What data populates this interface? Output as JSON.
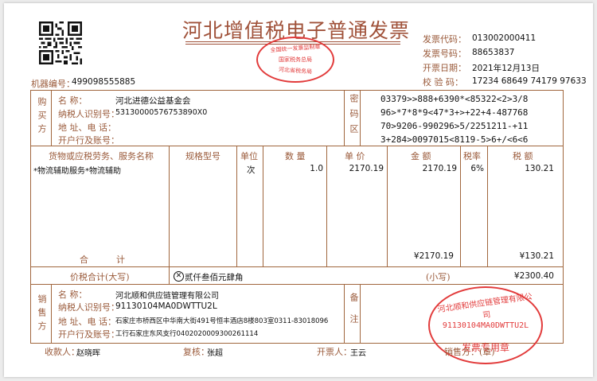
{
  "title": "河北增值税电子普通发票",
  "machine_no_label": "机器编号：",
  "machine_no": "499098555885",
  "header": {
    "code_label": "发票代码：",
    "code": "013002000411",
    "number_label": "发票号码：",
    "number": "88653837",
    "date_label": "开票日期：",
    "date": "2021年12月13日",
    "check_label": "校 验 码：",
    "check": "17234 68649 74179 97633"
  },
  "buyer": {
    "section_label": "购买方",
    "name_label": "名      称：",
    "name": "河北进德公益基金会",
    "tax_label": "纳税人识别号：",
    "tax_id": "53130000576753890X0",
    "addr_label": "地 址、电 话：",
    "bank_label": "开户行及账号："
  },
  "cipher": {
    "label": "密码区",
    "lines": [
      "03379>>888+6390*<85322<2>3/8",
      "96>*7*8*9<47*3+>+22+4-487768",
      "70>9206-990296>5/2251211-+11",
      "3+284>0097015<8119-5>6+/<6<6"
    ]
  },
  "items_header": {
    "name": "货物或应税劳务、服务名称",
    "spec": "规格型号",
    "unit": "单位",
    "qty": "数 量",
    "price": "单 价",
    "amount": "金 额",
    "rate": "税率",
    "tax": "税 额"
  },
  "items": [
    {
      "name": "*物流辅助服务*物流辅助",
      "spec": "",
      "unit": "次",
      "qty": "1.0",
      "price": "2170.19",
      "amount": "2170.19",
      "rate": "6%",
      "tax": "130.21"
    }
  ],
  "subtotal": {
    "label": "合          计",
    "amount": "¥2170.19",
    "tax": "¥130.21"
  },
  "total": {
    "label": "价税合计(大写)",
    "upper": "贰仟叁佰元肆角",
    "small_label": "(小写)",
    "small": "¥2300.40"
  },
  "seller": {
    "section_label": "销售方",
    "name_label": "名      称：",
    "name": "河北顺和供应链管理有限公司",
    "tax_label": "纳税人识别号：",
    "tax_id": "91130104MA0DWTTU2L",
    "addr_label": "地 址、电 话：",
    "addr": "石家庄市桥西区中华南大街491号恒丰酒店8楼803室0311-83018096",
    "bank_label": "开户行及账号：",
    "bank": "工行石家庄东风支行0402020009300261114"
  },
  "remark_label": "备注",
  "footer": {
    "payee_label": "收款人：",
    "payee": "赵晓晖",
    "reviewer_label": "复核：",
    "reviewer": "张超",
    "issuer_label": "开票人：",
    "issuer": "王云",
    "seller_sign_label": "销售方：(章)"
  },
  "stamps": {
    "tax_bureau_top": "全国统一发票监制章",
    "tax_bureau_mid": "国家税务总局",
    "tax_bureau_bottom": "河北省税务局",
    "seller_top": "河北顺和供应链管理有限公司",
    "seller_code": "91130104MA0DWTTU2L",
    "seller_bottom": "发票专用章"
  },
  "colors": {
    "frame": "#a0663d",
    "stamp": "#e23b3b",
    "title": "#a0523a"
  }
}
